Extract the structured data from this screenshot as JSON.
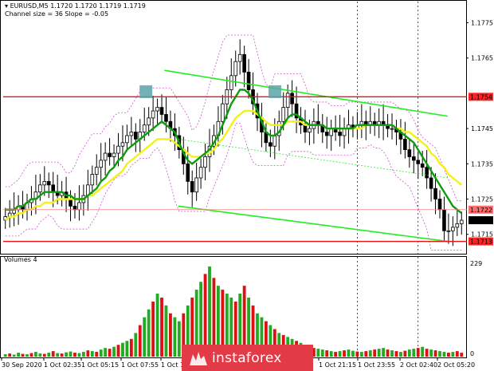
{
  "header": {
    "symbol_line": "EURUSD,M5  1.1720 1.1720 1.1719 1.1719",
    "indicator_line": "Channel size = 36 Slope = -0.05"
  },
  "volume_panel": {
    "title": "Volumes 4",
    "max_label": "229",
    "zero_label": "0"
  },
  "brand": {
    "name": "instaforex",
    "icon": "instaforex-logo-icon"
  },
  "colors": {
    "candle": "#000000",
    "sma_green": "#0d9c0d",
    "sma_yellow": "#f2f21a",
    "channel": "#22ee22",
    "level": "#ee1111",
    "envelope": "#cc55cc",
    "vol_up": "#22aa22",
    "vol_down": "#dd1111",
    "marker": "#5aa6a8",
    "price_tag": "#ff2222"
  },
  "chart_data": [
    {
      "type": "candlestick",
      "symbol": "EURUSD",
      "timeframe": "M5",
      "ylim": [
        1.17095,
        1.1781
      ],
      "y_ticks": [
        "1.1775",
        "1.1765",
        "1.1754",
        "1.1745",
        "1.1735",
        "1.1725",
        "1.1722",
        "1.1719",
        "1.1715",
        "1.1713"
      ],
      "x_tick_labels": [
        "30 Sep 2020",
        "1 Oct 02:35",
        "1 Oct 05:15",
        "1 Oct 07:55",
        "1 Oct 10:",
        "1 Oct 21:15",
        "1 Oct 23:55",
        "2 Oct 02:40",
        "2 Oct 05:20"
      ],
      "levels": [
        {
          "name": "resistance",
          "value": 1.1754,
          "label": "1.1754"
        },
        {
          "name": "support",
          "value": 1.1713,
          "label": "1.1713"
        }
      ],
      "current_price": {
        "value": 1.1719,
        "label": "1.1719"
      },
      "bid_line": {
        "value": 1.1722,
        "label": "1.1722"
      },
      "channel": {
        "upper": [
          [
            0.35,
            1.17615
          ],
          [
            0.965,
            1.17485
          ]
        ],
        "lower": [
          [
            0.38,
            1.1723
          ],
          [
            0.965,
            1.1713
          ]
        ],
        "middle": [
          [
            0.38,
            1.1742
          ],
          [
            0.965,
            1.1731
          ]
        ]
      },
      "markers": [
        {
          "x": 0.31,
          "y": 1.1755
        },
        {
          "x": 0.59,
          "y": 1.1755
        }
      ],
      "close": [
        1.172,
        1.1721,
        1.1722,
        1.1723,
        1.1722,
        1.1724,
        1.1725,
        1.1727,
        1.1729,
        1.173,
        1.1729,
        1.1727,
        1.1726,
        1.1727,
        1.1725,
        1.1723,
        1.1722,
        1.1724,
        1.1726,
        1.1729,
        1.1732,
        1.1734,
        1.1736,
        1.1738,
        1.1737,
        1.1738,
        1.174,
        1.1741,
        1.1743,
        1.1744,
        1.1742,
        1.1744,
        1.1746,
        1.1748,
        1.175,
        1.1751,
        1.1749,
        1.1747,
        1.1745,
        1.1743,
        1.1739,
        1.1735,
        1.173,
        1.1727,
        1.1731,
        1.1734,
        1.1737,
        1.174,
        1.1743,
        1.1747,
        1.1752,
        1.1756,
        1.176,
        1.1764,
        1.1766,
        1.1761,
        1.1756,
        1.1752,
        1.1748,
        1.1744,
        1.1741,
        1.174,
        1.1743,
        1.1747,
        1.1751,
        1.1755,
        1.1752,
        1.1748,
        1.1746,
        1.1744,
        1.1745,
        1.1747,
        1.1746,
        1.1744,
        1.1743,
        1.1745,
        1.1744,
        1.1743,
        1.1745,
        1.1746,
        1.1745,
        1.1746,
        1.1747,
        1.1746,
        1.1747,
        1.1746,
        1.1747,
        1.1746,
        1.1745,
        1.1745,
        1.1744,
        1.1742,
        1.1739,
        1.1737,
        1.1736,
        1.1735,
        1.1734,
        1.1731,
        1.1728,
        1.1725,
        1.1722,
        1.1716,
        1.1716,
        1.1717,
        1.1718,
        1.1719
      ],
      "sma_green": [
        1.1722,
        1.1722,
        1.1722,
        1.1723,
        1.1723,
        1.1724,
        1.1725,
        1.1725,
        1.1726,
        1.1727,
        1.1727,
        1.1727,
        1.1727,
        1.1727,
        1.1726,
        1.1726,
        1.1725,
        1.1725,
        1.1725,
        1.1726,
        1.1727,
        1.1728,
        1.173,
        1.1731,
        1.1733,
        1.1734,
        1.1736,
        1.1737,
        1.1739,
        1.174,
        1.1741,
        1.1742,
        1.1743,
        1.1744,
        1.1745,
        1.1746,
        1.1747,
        1.1746,
        1.1745,
        1.1744,
        1.1741,
        1.1738,
        1.1736,
        1.1735,
        1.1736,
        1.1737,
        1.1738,
        1.1739,
        1.1741,
        1.1743,
        1.1746,
        1.1749,
        1.1752,
        1.1754,
        1.1756,
        1.1756,
        1.1755,
        1.1753,
        1.175,
        1.1747,
        1.1744,
        1.1743,
        1.1743,
        1.1744,
        1.1746,
        1.1748,
        1.1749,
        1.1749,
        1.1748,
        1.1747,
        1.1746,
        1.1746,
        1.1746,
        1.1746,
        1.1745,
        1.1745,
        1.1745,
        1.1745,
        1.1745,
        1.1745,
        1.1745,
        1.1746,
        1.1746,
        1.1746,
        1.1746,
        1.1746,
        1.1746,
        1.1746,
        1.1746,
        1.1746,
        1.1745,
        1.1744,
        1.1743,
        1.1742,
        1.1741,
        1.1739,
        1.1737,
        1.1735,
        1.1733,
        1.1731,
        1.1729,
        1.1727,
        1.1725,
        1.1723,
        1.1722,
        1.1721
      ],
      "sma_yellow": [
        1.1719,
        1.172,
        1.172,
        1.1721,
        1.1721,
        1.1722,
        1.1722,
        1.1723,
        1.1723,
        1.1724,
        1.1724,
        1.1724,
        1.1725,
        1.1725,
        1.1725,
        1.1725,
        1.1725,
        1.1725,
        1.1725,
        1.1726,
        1.1726,
        1.1727,
        1.1728,
        1.1729,
        1.173,
        1.1731,
        1.1732,
        1.1733,
        1.1735,
        1.1736,
        1.1737,
        1.1738,
        1.1739,
        1.174,
        1.1741,
        1.1742,
        1.1742,
        1.1742,
        1.1742,
        1.1741,
        1.174,
        1.1739,
        1.1738,
        1.1737,
        1.1737,
        1.1737,
        1.1738,
        1.1738,
        1.1739,
        1.1741,
        1.1742,
        1.1744,
        1.1746,
        1.1748,
        1.1749,
        1.175,
        1.175,
        1.175,
        1.1749,
        1.1748,
        1.1747,
        1.1746,
        1.1746,
        1.1746,
        1.1746,
        1.1747,
        1.1747,
        1.1747,
        1.1747,
        1.1746,
        1.1746,
        1.1746,
        1.1746,
        1.1746,
        1.1745,
        1.1745,
        1.1745,
        1.1745,
        1.1745,
        1.1745,
        1.1745,
        1.1745,
        1.1745,
        1.1746,
        1.1746,
        1.1746,
        1.1746,
        1.1746,
        1.1746,
        1.1746,
        1.1745,
        1.1745,
        1.1744,
        1.1744,
        1.1743,
        1.1742,
        1.1741,
        1.174,
        1.1738,
        1.1737,
        1.1735,
        1.1734,
        1.1732,
        1.1731,
        1.173,
        1.1729
      ]
    },
    {
      "type": "bar",
      "name": "Volumes",
      "ylim": [
        0,
        229
      ],
      "values": [
        6,
        8,
        5,
        10,
        7,
        6,
        9,
        12,
        8,
        7,
        10,
        14,
        9,
        8,
        11,
        13,
        10,
        9,
        12,
        16,
        14,
        12,
        18,
        22,
        20,
        25,
        30,
        35,
        40,
        45,
        60,
        80,
        100,
        120,
        140,
        160,
        150,
        130,
        110,
        100,
        90,
        110,
        130,
        150,
        170,
        190,
        210,
        229,
        200,
        180,
        170,
        160,
        150,
        140,
        160,
        180,
        150,
        130,
        110,
        100,
        90,
        80,
        70,
        60,
        55,
        50,
        45,
        40,
        35,
        30,
        25,
        22,
        20,
        18,
        16,
        14,
        12,
        14,
        16,
        18,
        15,
        13,
        12,
        14,
        16,
        18,
        20,
        22,
        18,
        16,
        14,
        12,
        15,
        18,
        20,
        22,
        25,
        20,
        18,
        16,
        14,
        12,
        10,
        12,
        14,
        10
      ],
      "up": [
        1,
        0,
        1,
        1,
        0,
        1,
        0,
        1,
        1,
        0,
        1,
        0,
        1,
        0,
        1,
        1,
        0,
        1,
        1,
        0,
        1,
        0,
        1,
        1,
        0,
        1,
        0,
        1,
        1,
        0,
        1,
        0,
        1,
        1,
        0,
        1,
        0,
        1,
        0,
        1,
        1,
        0,
        1,
        0,
        1,
        1,
        0,
        1,
        0,
        1,
        0,
        1,
        1,
        0,
        1,
        0,
        1,
        0,
        1,
        1,
        0,
        1,
        0,
        1,
        0,
        1,
        1,
        0,
        1,
        0,
        1,
        0,
        1,
        1,
        0,
        1,
        0,
        1,
        0,
        1,
        1,
        0,
        1,
        0,
        1,
        0,
        1,
        1,
        0,
        1,
        0,
        1,
        0,
        1,
        1,
        0,
        1,
        0,
        1,
        0,
        1,
        1,
        0,
        1,
        0,
        0
      ]
    }
  ]
}
